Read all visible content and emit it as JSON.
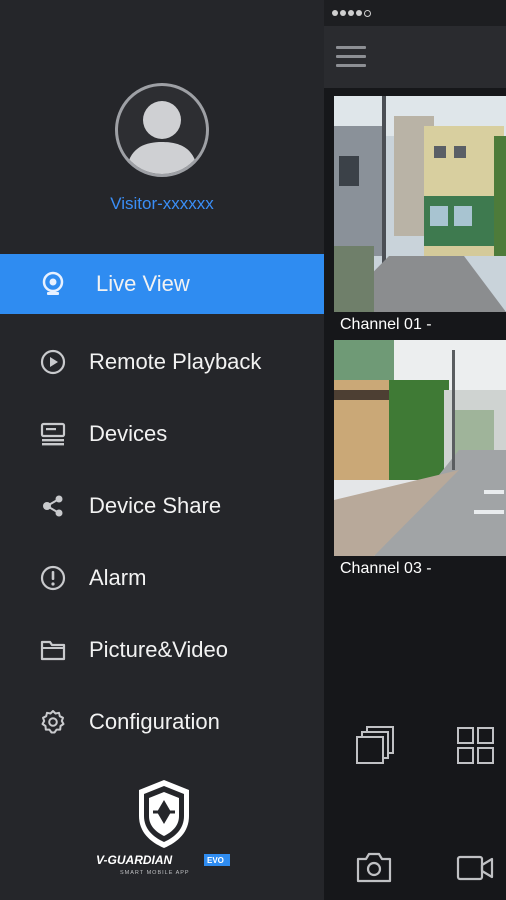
{
  "user": {
    "name": "Visitor-xxxxxx"
  },
  "menu": {
    "items": [
      {
        "label": "Live View",
        "icon": "camera-icon",
        "active": true
      },
      {
        "label": "Remote Playback",
        "icon": "play-circle-icon",
        "active": false
      },
      {
        "label": "Devices",
        "icon": "devices-icon",
        "active": false
      },
      {
        "label": "Device Share",
        "icon": "share-icon",
        "active": false
      },
      {
        "label": "Alarm",
        "icon": "alert-icon",
        "active": false
      },
      {
        "label": "Picture&Video",
        "icon": "folder-icon",
        "active": false
      },
      {
        "label": "Configuration",
        "icon": "gear-icon",
        "active": false
      }
    ]
  },
  "brand": {
    "name": "V-GUARDIAN",
    "badge": "EVO",
    "tagline": "SMART MOBILE APP"
  },
  "channels": [
    {
      "label": "Channel 01 -"
    },
    {
      "label": "Channel 03 -"
    }
  ],
  "colors": {
    "accent": "#2f8cf1",
    "username": "#3a8ef6",
    "drawer_bg": "#25262a"
  }
}
